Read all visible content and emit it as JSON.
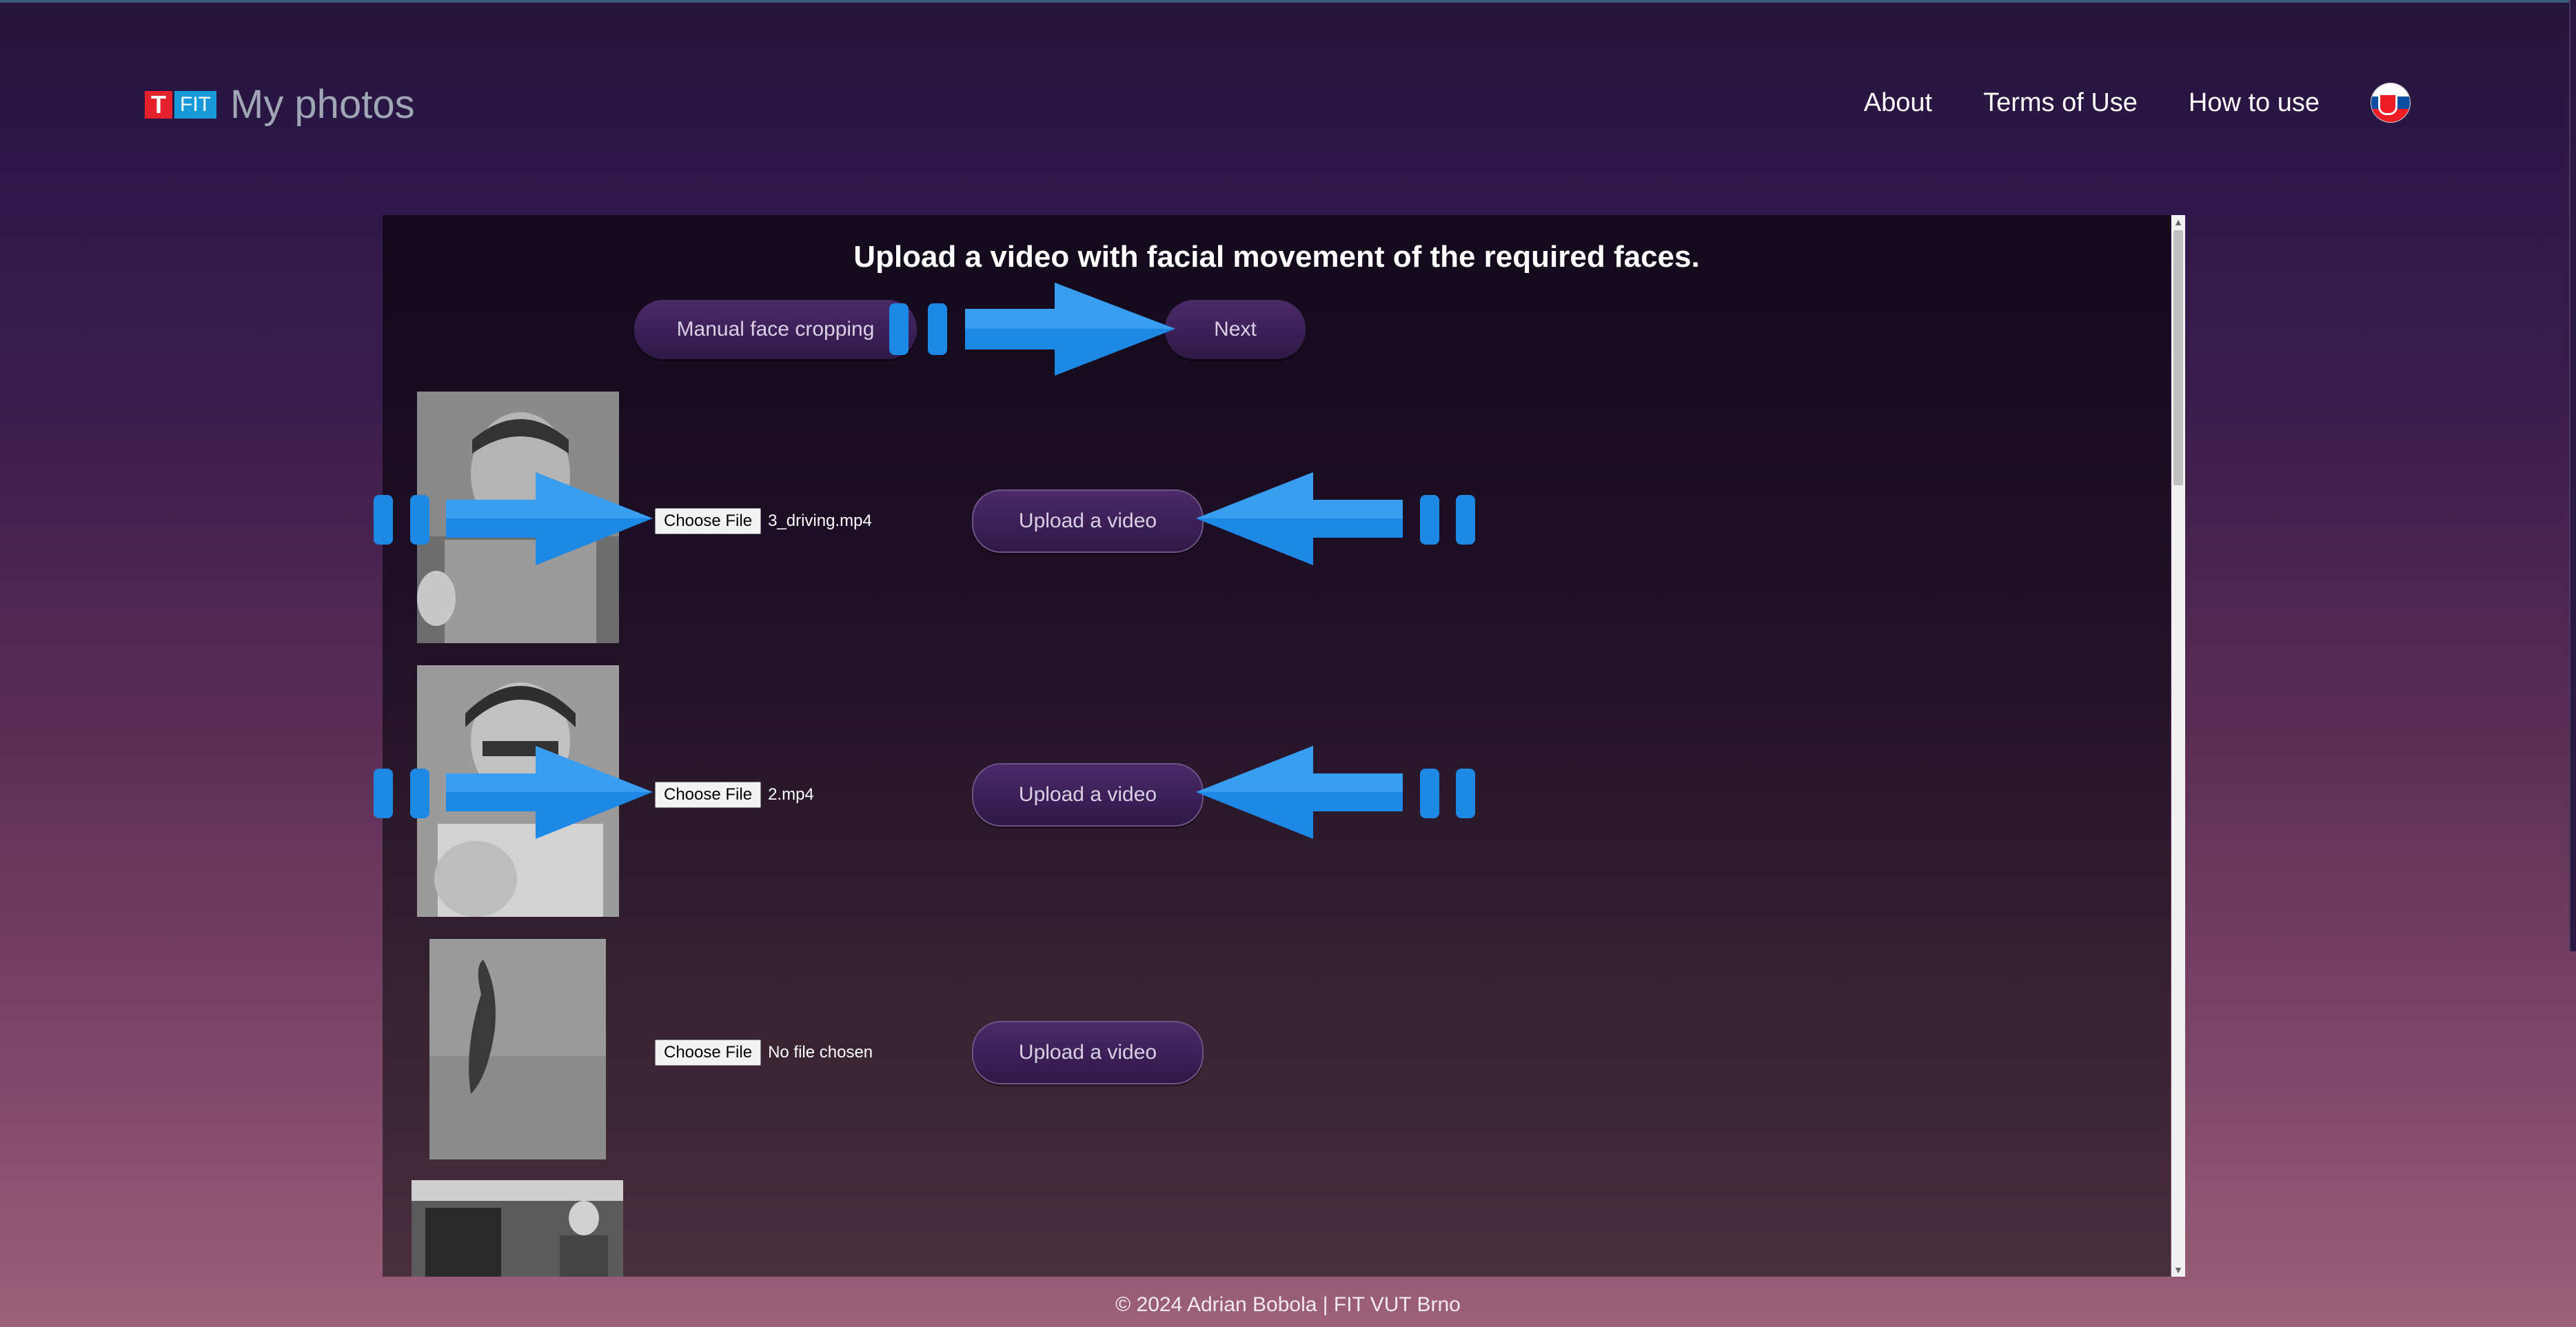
{
  "header": {
    "logo_t": "T",
    "logo_fit": "FIT",
    "title": "My photos",
    "nav": [
      "About",
      "Terms of Use",
      "How to use"
    ],
    "language_flag": "slovak-flag-icon"
  },
  "main": {
    "heading": "Upload a video with facial movement of the required faces.",
    "manual_crop_label": "Manual face cropping",
    "next_label": "Next",
    "rows": [
      {
        "choose_label": "Choose File",
        "file_name": "3_driving.mp4",
        "upload_label": "Upload a video"
      },
      {
        "choose_label": "Choose File",
        "file_name": "2.mp4",
        "upload_label": "Upload a video"
      },
      {
        "choose_label": "Choose File",
        "file_name": "No file chosen",
        "upload_label": "Upload a video"
      }
    ]
  },
  "footer": {
    "text": "© 2024 Adrian Bobola | FIT VUT Brno"
  },
  "colors": {
    "accent_arrow": "#1e88e5",
    "button_bg": "#3a1f55",
    "logo_red": "#e4212c",
    "logo_blue": "#199ad8"
  }
}
